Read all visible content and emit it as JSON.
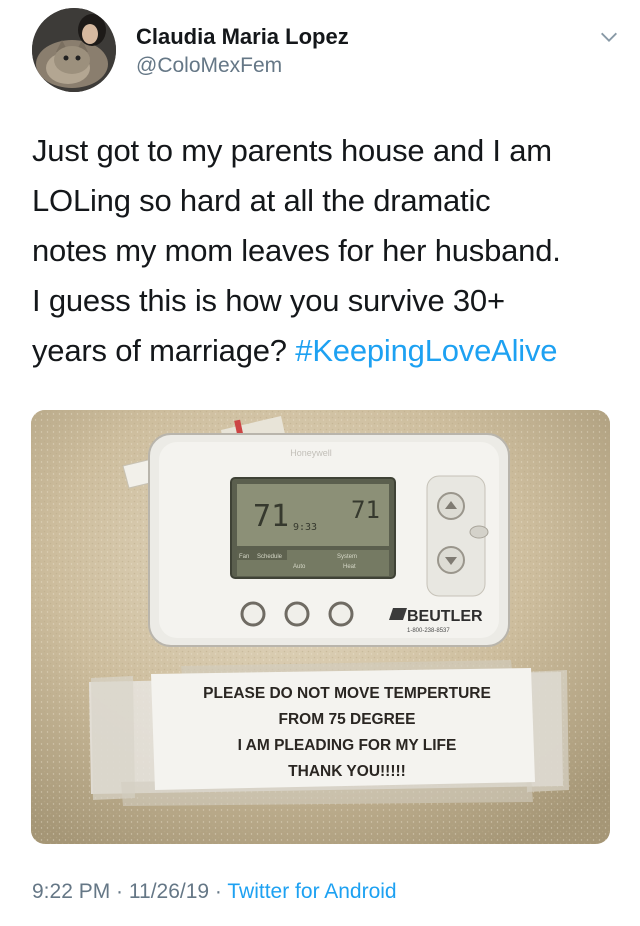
{
  "user": {
    "display_name": "Claudia Maria Lopez",
    "handle": "@ColoMexFem",
    "avatar_icon": "user-with-cat-avatar"
  },
  "tweet": {
    "lines": [
      "Just got to my parents house and I am",
      "LOLing so hard at all the dramatic",
      "notes my mom leaves for her husband.",
      "I guess this is how you survive 30+",
      "years of marriage?"
    ],
    "hashtag": "#KeepingLoveAlive"
  },
  "photo": {
    "thermostat_display": {
      "left_temp": "71",
      "time": "9:33",
      "right_temp": "71",
      "labels": [
        "Fan",
        "Schedule",
        "Auto",
        "System",
        "Heat"
      ]
    },
    "brand": "BEUTLER",
    "phone": "1-800-238-8537",
    "note_lines": [
      "PLEASE DO NOT MOVE TEMPERTURE",
      "FROM 75 DEGREE",
      "I AM PLEADING FOR MY LIFE",
      "THANK YOU!!!!!"
    ]
  },
  "meta": {
    "time": "9:22 PM",
    "separator": " · ",
    "date": "11/26/19",
    "source": "Twitter for Android"
  },
  "colors": {
    "link": "#1da1f2",
    "secondary_text": "#657786",
    "wall": "#cbbb9c"
  }
}
